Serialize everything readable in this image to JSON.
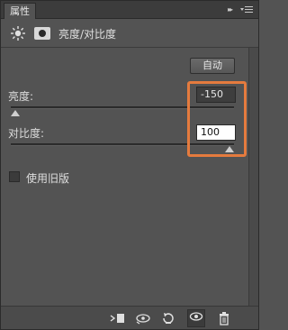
{
  "panel": {
    "tab_label": "属性",
    "collapse_glyph": "▸▸"
  },
  "header": {
    "title": "亮度/对比度",
    "adjustment_icon": "sun-icon",
    "mask_icon": "layer-mask-icon"
  },
  "controls": {
    "auto_label": "自动",
    "brightness_label": "亮度:",
    "brightness_value": "-150",
    "brightness_level": 0.0,
    "contrast_label": "对比度:",
    "contrast_value": "100",
    "contrast_level": 1.0,
    "legacy_label": "使用旧版",
    "legacy_checked": false
  },
  "toolbar": {
    "clip_icon": "clip-to-layer-icon",
    "view_previous_icon": "view-previous-state-icon",
    "reset_icon": "reset-icon",
    "visibility_icon": "eye-icon",
    "delete_icon": "trash-icon"
  },
  "colors": {
    "panel_bg": "#535353",
    "highlight": "#e57b3e"
  }
}
